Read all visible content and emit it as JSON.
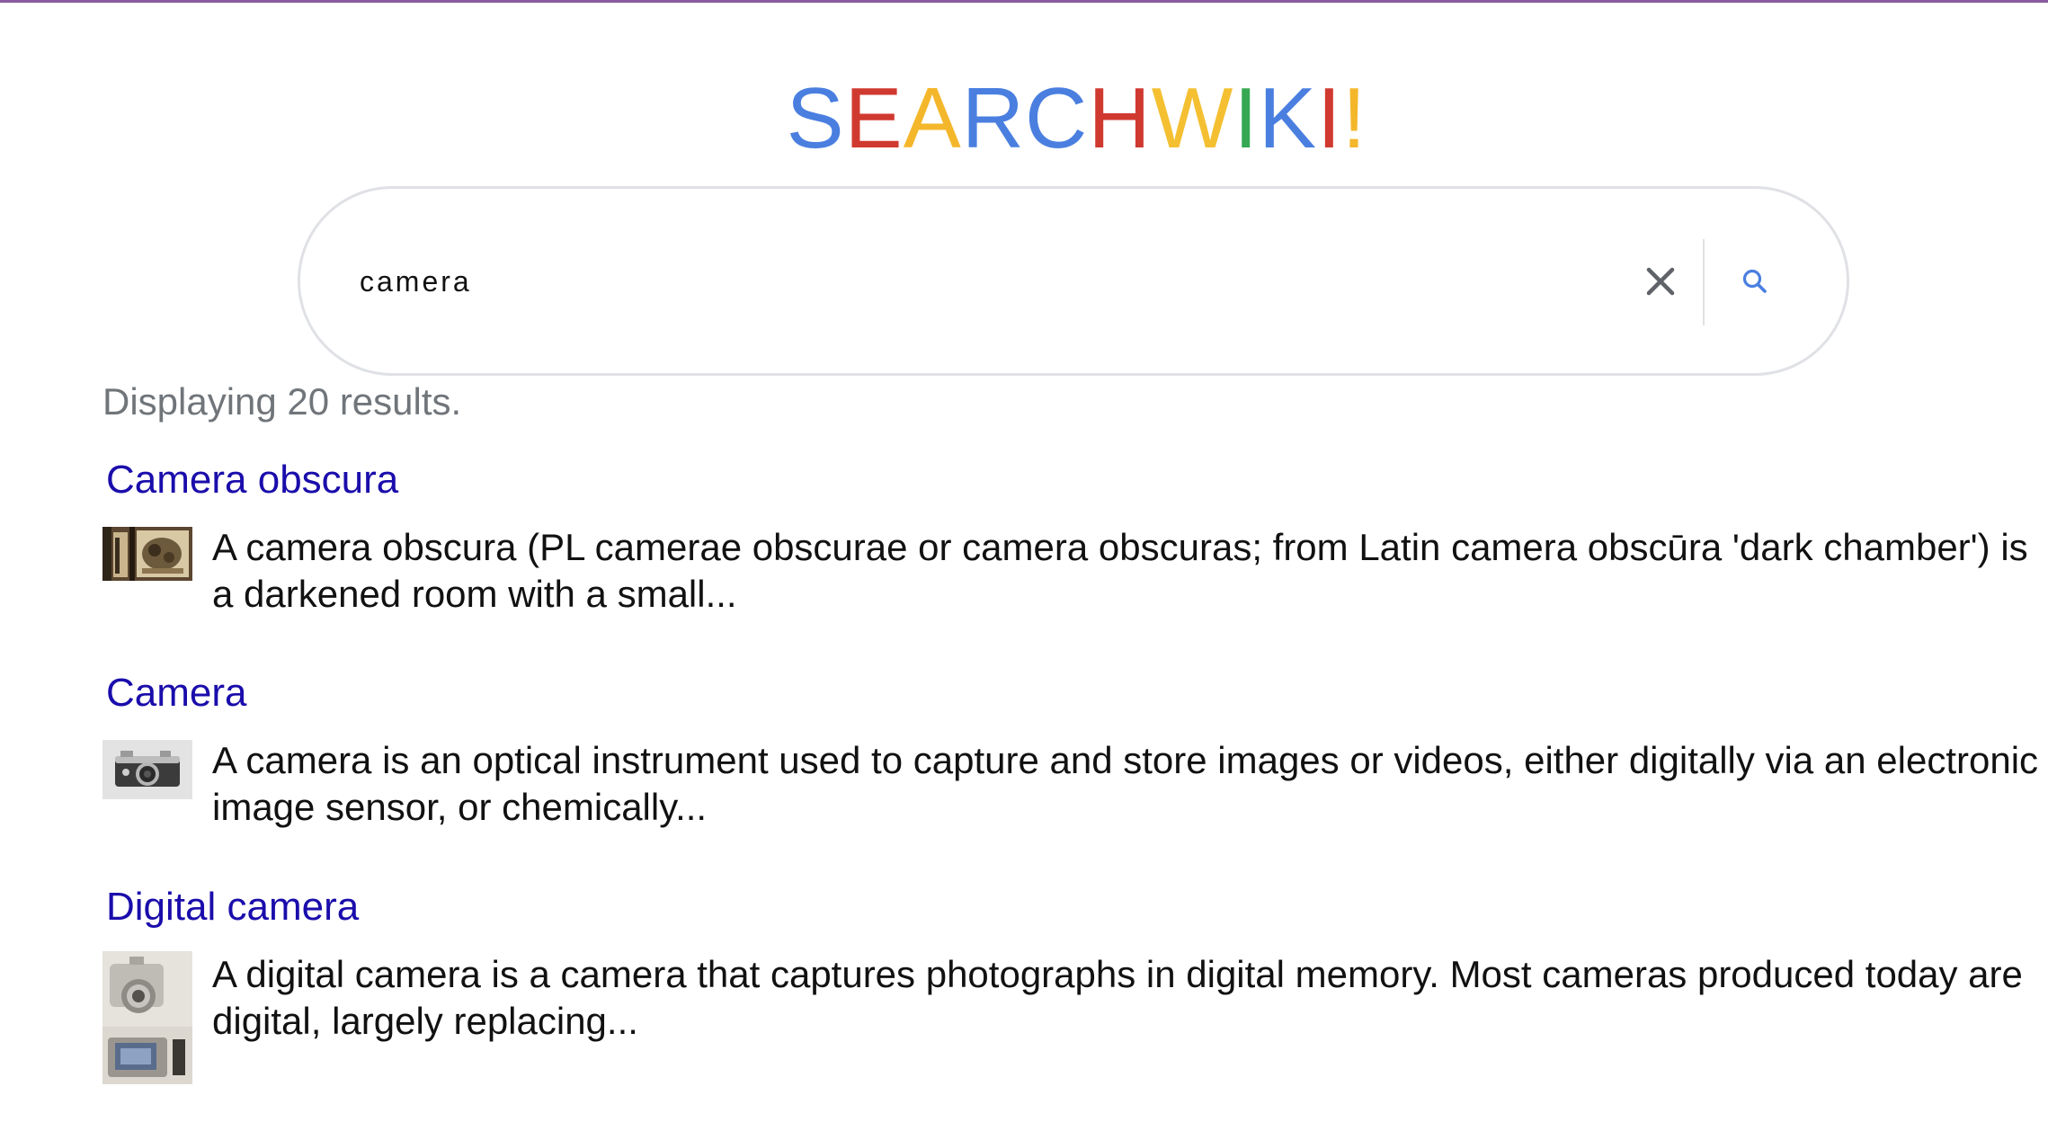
{
  "header": {
    "logo_letters": [
      {
        "char": "S",
        "color": "#4a7fe0"
      },
      {
        "char": "E",
        "color": "#d0392f"
      },
      {
        "char": "A",
        "color": "#f4b72b"
      },
      {
        "char": "R",
        "color": "#4a7fe0"
      },
      {
        "char": "C",
        "color": "#4a7fe0"
      },
      {
        "char": "H",
        "color": "#d0392f"
      },
      {
        "char": "W",
        "color": "#f4c032"
      },
      {
        "char": "I",
        "color": "#36a852"
      },
      {
        "char": "K",
        "color": "#4a7fe0"
      },
      {
        "char": "I",
        "color": "#d0392f"
      },
      {
        "char": "!",
        "color": "#f4b72b"
      }
    ]
  },
  "search": {
    "value": "camera",
    "clear_icon": "close-icon",
    "search_icon": "search-icon",
    "accent_color": "#4a7fe0"
  },
  "results_summary": {
    "text": "Displaying 20 results."
  },
  "results": [
    {
      "title": "Camera obscura",
      "snippet": "A camera obscura (PL camerae obscurae or camera obscuras; from Latin camera obscūra 'dark chamber') is a darkened room with a small...",
      "thumbnail": "camera-obscura-thumbnail"
    },
    {
      "title": "Camera",
      "snippet": "A camera is an optical instrument used to capture and store images or videos, either digitally via an electronic image sensor, or chemically...",
      "thumbnail": "camera-thumbnail"
    },
    {
      "title": "Digital camera",
      "snippet": "A digital camera is a camera that captures photographs in digital memory. Most cameras produced today are digital, largely replacing...",
      "thumbnail": "digital-camera-thumbnail"
    }
  ],
  "colors": {
    "link": "#1a0dab",
    "muted_text": "#70757a",
    "border": "#dfe1e5"
  }
}
